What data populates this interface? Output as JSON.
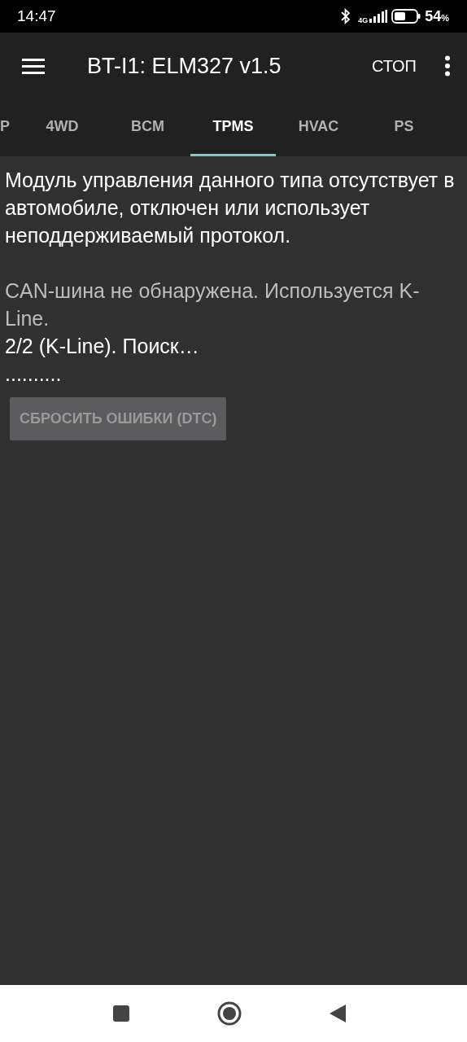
{
  "status_bar": {
    "time": "14:47",
    "network": "4G",
    "battery": "54",
    "battery_unit": "%"
  },
  "toolbar": {
    "title": "BT-I1: ELM327 v1.5",
    "action": "СТОП"
  },
  "tabs": [
    {
      "label": "P",
      "selected": false
    },
    {
      "label": "4WD",
      "selected": false
    },
    {
      "label": "BCM",
      "selected": false
    },
    {
      "label": "TPMS",
      "selected": true
    },
    {
      "label": "HVAC",
      "selected": false
    },
    {
      "label": "PS",
      "selected": false
    }
  ],
  "messages": [
    {
      "kind": "primary",
      "text": "Модуль управления данного типа отсутствует в автомобиле, отключен или использует неподдерживаемый протокол."
    },
    {
      "kind": "gap"
    },
    {
      "kind": "secondary",
      "text": "CAN-шина не обнаружена. Используется K-Line."
    },
    {
      "kind": "primary",
      "text": "2/2 (K-Line). Поиск…"
    },
    {
      "kind": "primary",
      "text": ".........."
    }
  ],
  "reset_button": {
    "label": "СБРОСИТЬ ОШИБКИ (DTC)",
    "disabled": true
  }
}
